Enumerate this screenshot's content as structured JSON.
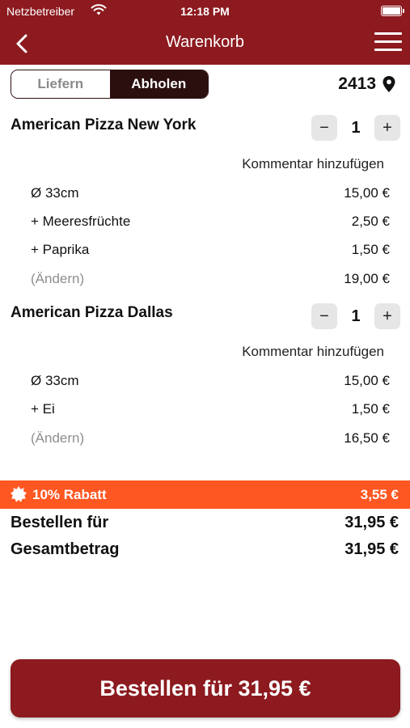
{
  "status": {
    "carrier": "Netzbetreiber",
    "time": "12:18 PM"
  },
  "nav": {
    "title": "Warenkorb"
  },
  "mode": {
    "deliver": "Liefern",
    "pickup": "Abholen",
    "selected": "Abholen"
  },
  "zip": "2413",
  "items": [
    {
      "name": "American Pizza New York",
      "qty": "1",
      "comment": "Kommentar hinzufügen",
      "lines": [
        {
          "label": "Ø 33cm",
          "price": "15,00 €"
        },
        {
          "label": "+ Meeresfrüchte",
          "price": "2,50 €"
        },
        {
          "label": "+ Paprika",
          "price": "1,50 €"
        }
      ],
      "change": "(Ändern)",
      "subtotal": "19,00 €"
    },
    {
      "name": "American Pizza Dallas",
      "qty": "1",
      "comment": "Kommentar hinzufügen",
      "lines": [
        {
          "label": "Ø 33cm",
          "price": "15,00 €"
        },
        {
          "label": "+ Ei",
          "price": "1,50 €"
        }
      ],
      "change": "(Ändern)",
      "subtotal": "16,50 €"
    }
  ],
  "discount": {
    "label": "10% Rabatt",
    "amount": "3,55 €"
  },
  "totals": {
    "order_label": "Bestellen für",
    "order_value": "31,95 €",
    "total_label": "Gesamtbetrag",
    "total_value": "31,95 €"
  },
  "order_button": "Bestellen für 31,95 €",
  "colors": {
    "brand": "#8c1a1f",
    "discount": "#ff5722",
    "segment_dark": "#2b0f0f"
  },
  "icons": {
    "back": "chevron-left-icon",
    "menu": "hamburger-menu-icon",
    "location": "location-pin-icon",
    "discount": "badge-icon",
    "wifi": "wifi-icon",
    "battery": "battery-icon"
  }
}
